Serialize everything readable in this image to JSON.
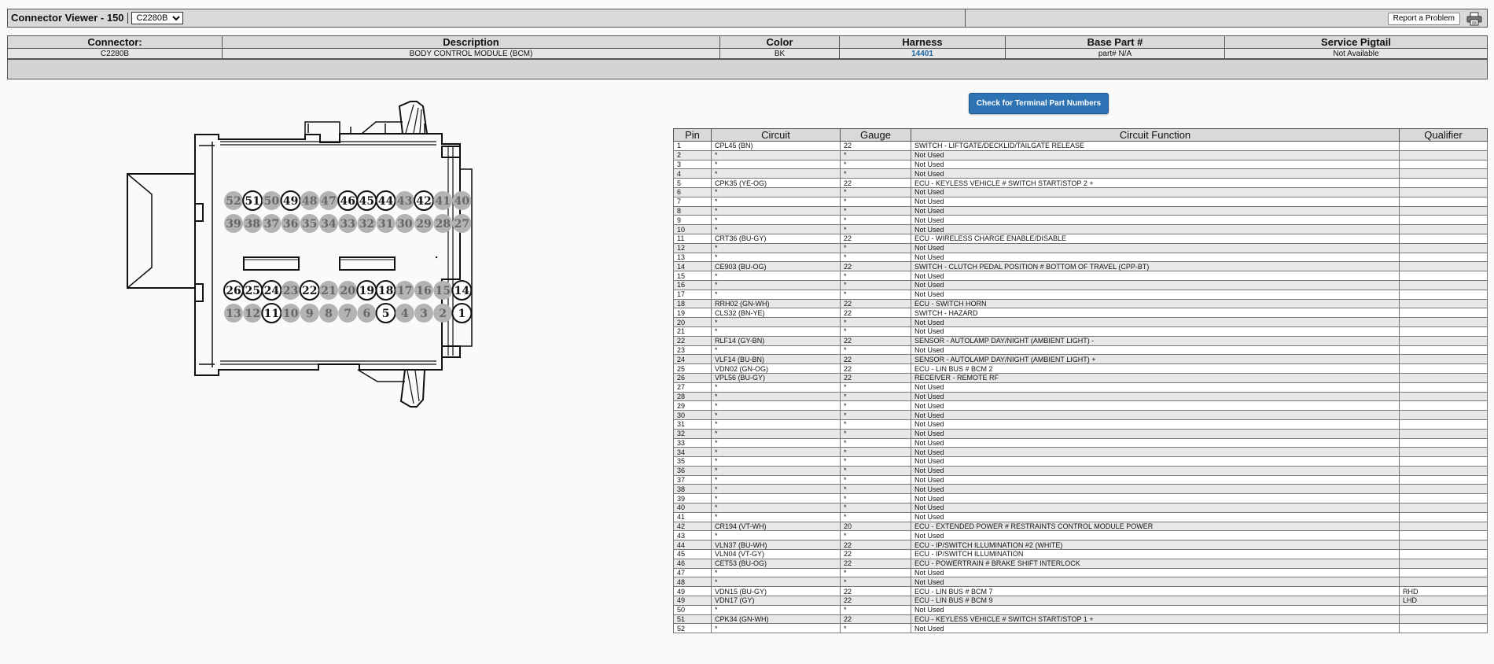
{
  "window": {
    "title": "Connector Viewer - 150",
    "selected_connector": "C2280B",
    "report_label": "Report a Problem",
    "print_icon": "printer-icon"
  },
  "info_table": {
    "headers": [
      "Connector:",
      "Description",
      "Color",
      "Harness",
      "Base Part #",
      "Service Pigtail"
    ],
    "values": [
      "C2280B",
      "BODY CONTROL MODULE (BCM)",
      "BK",
      "14401",
      "part# N/A",
      "Not Available"
    ]
  },
  "check_button": "Check for Terminal Part Numbers",
  "connector_pins": {
    "row1": [
      {
        "n": "52",
        "active": false
      },
      {
        "n": "51",
        "active": true
      },
      {
        "n": "50",
        "active": false
      },
      {
        "n": "49",
        "active": true
      },
      {
        "n": "48",
        "active": false
      },
      {
        "n": "47",
        "active": false
      },
      {
        "n": "46",
        "active": true
      },
      {
        "n": "45",
        "active": true
      },
      {
        "n": "44",
        "active": true
      },
      {
        "n": "43",
        "active": false
      },
      {
        "n": "42",
        "active": true
      },
      {
        "n": "41",
        "active": false
      },
      {
        "n": "40",
        "active": false
      }
    ],
    "row2": [
      {
        "n": "39",
        "active": false
      },
      {
        "n": "38",
        "active": false
      },
      {
        "n": "37",
        "active": false
      },
      {
        "n": "36",
        "active": false
      },
      {
        "n": "35",
        "active": false
      },
      {
        "n": "34",
        "active": false
      },
      {
        "n": "33",
        "active": false
      },
      {
        "n": "32",
        "active": false
      },
      {
        "n": "31",
        "active": false
      },
      {
        "n": "30",
        "active": false
      },
      {
        "n": "29",
        "active": false
      },
      {
        "n": "28",
        "active": false
      },
      {
        "n": "27",
        "active": false
      }
    ],
    "row3": [
      {
        "n": "26",
        "active": true
      },
      {
        "n": "25",
        "active": true
      },
      {
        "n": "24",
        "active": true
      },
      {
        "n": "23",
        "active": false
      },
      {
        "n": "22",
        "active": true
      },
      {
        "n": "21",
        "active": false
      },
      {
        "n": "20",
        "active": false
      },
      {
        "n": "19",
        "active": true
      },
      {
        "n": "18",
        "active": true
      },
      {
        "n": "17",
        "active": false
      },
      {
        "n": "16",
        "active": false
      },
      {
        "n": "15",
        "active": false
      },
      {
        "n": "14",
        "active": true
      }
    ],
    "row4": [
      {
        "n": "13",
        "active": false
      },
      {
        "n": "12",
        "active": false
      },
      {
        "n": "11",
        "active": true
      },
      {
        "n": "10",
        "active": false
      },
      {
        "n": "9",
        "active": false
      },
      {
        "n": "8",
        "active": false
      },
      {
        "n": "7",
        "active": false
      },
      {
        "n": "6",
        "active": false
      },
      {
        "n": "5",
        "active": true
      },
      {
        "n": "4",
        "active": false
      },
      {
        "n": "3",
        "active": false
      },
      {
        "n": "2",
        "active": false
      },
      {
        "n": "1",
        "active": true
      }
    ]
  },
  "pin_table": {
    "headers": [
      "Pin",
      "Circuit",
      "Gauge",
      "Circuit Function",
      "Qualifier"
    ],
    "rows": [
      [
        "1",
        "CPL45 (BN)",
        "22",
        "SWITCH - LIFTGATE/DECKLID/TAILGATE RELEASE",
        ""
      ],
      [
        "2",
        "*",
        "*",
        "Not Used",
        ""
      ],
      [
        "3",
        "*",
        "*",
        "Not Used",
        ""
      ],
      [
        "4",
        "*",
        "*",
        "Not Used",
        ""
      ],
      [
        "5",
        "CPK35 (YE-OG)",
        "22",
        "ECU - KEYLESS VEHICLE # SWITCH START/STOP 2 +",
        ""
      ],
      [
        "6",
        "*",
        "*",
        "Not Used",
        ""
      ],
      [
        "7",
        "*",
        "*",
        "Not Used",
        ""
      ],
      [
        "8",
        "*",
        "*",
        "Not Used",
        ""
      ],
      [
        "9",
        "*",
        "*",
        "Not Used",
        ""
      ],
      [
        "10",
        "*",
        "*",
        "Not Used",
        ""
      ],
      [
        "11",
        "CRT36 (BU-GY)",
        "22",
        "ECU - WIRELESS CHARGE ENABLE/DISABLE",
        ""
      ],
      [
        "12",
        "*",
        "*",
        "Not Used",
        ""
      ],
      [
        "13",
        "*",
        "*",
        "Not Used",
        ""
      ],
      [
        "14",
        "CE903 (BU-OG)",
        "22",
        "SWITCH - CLUTCH PEDAL POSITION # BOTTOM OF TRAVEL (CPP-BT)",
        ""
      ],
      [
        "15",
        "*",
        "*",
        "Not Used",
        ""
      ],
      [
        "16",
        "*",
        "*",
        "Not Used",
        ""
      ],
      [
        "17",
        "*",
        "*",
        "Not Used",
        ""
      ],
      [
        "18",
        "RRH02 (GN-WH)",
        "22",
        "ECU - SWITCH HORN",
        ""
      ],
      [
        "19",
        "CLS32 (BN-YE)",
        "22",
        "SWITCH - HAZARD",
        ""
      ],
      [
        "20",
        "*",
        "*",
        "Not Used",
        ""
      ],
      [
        "21",
        "*",
        "*",
        "Not Used",
        ""
      ],
      [
        "22",
        "RLF14 (GY-BN)",
        "22",
        "SENSOR - AUTOLAMP DAY/NIGHT (AMBIENT LIGHT) -",
        ""
      ],
      [
        "23",
        "*",
        "*",
        "Not Used",
        ""
      ],
      [
        "24",
        "VLF14 (BU-BN)",
        "22",
        "SENSOR - AUTOLAMP DAY/NIGHT (AMBIENT LIGHT) +",
        ""
      ],
      [
        "25",
        "VDN02 (GN-OG)",
        "22",
        "ECU - LIN BUS # BCM 2",
        ""
      ],
      [
        "26",
        "VPL56 (BU-GY)",
        "22",
        "RECEIVER - REMOTE RF",
        ""
      ],
      [
        "27",
        "*",
        "*",
        "Not Used",
        ""
      ],
      [
        "28",
        "*",
        "*",
        "Not Used",
        ""
      ],
      [
        "29",
        "*",
        "*",
        "Not Used",
        ""
      ],
      [
        "30",
        "*",
        "*",
        "Not Used",
        ""
      ],
      [
        "31",
        "*",
        "*",
        "Not Used",
        ""
      ],
      [
        "32",
        "*",
        "*",
        "Not Used",
        ""
      ],
      [
        "33",
        "*",
        "*",
        "Not Used",
        ""
      ],
      [
        "34",
        "*",
        "*",
        "Not Used",
        ""
      ],
      [
        "35",
        "*",
        "*",
        "Not Used",
        ""
      ],
      [
        "36",
        "*",
        "*",
        "Not Used",
        ""
      ],
      [
        "37",
        "*",
        "*",
        "Not Used",
        ""
      ],
      [
        "38",
        "*",
        "*",
        "Not Used",
        ""
      ],
      [
        "39",
        "*",
        "*",
        "Not Used",
        ""
      ],
      [
        "40",
        "*",
        "*",
        "Not Used",
        ""
      ],
      [
        "41",
        "*",
        "*",
        "Not Used",
        ""
      ],
      [
        "42",
        "CR194 (VT-WH)",
        "20",
        "ECU - EXTENDED POWER # RESTRAINTS CONTROL MODULE POWER",
        ""
      ],
      [
        "43",
        "*",
        "*",
        "Not Used",
        ""
      ],
      [
        "44",
        "VLN37 (BU-WH)",
        "22",
        "ECU - IP/SWITCH ILLUMINATION #2 (WHITE)",
        ""
      ],
      [
        "45",
        "VLN04 (VT-GY)",
        "22",
        "ECU - IP/SWITCH ILLUMINATION",
        ""
      ],
      [
        "46",
        "CET53 (BU-OG)",
        "22",
        "ECU - POWERTRAIN # BRAKE SHIFT INTERLOCK",
        ""
      ],
      [
        "47",
        "*",
        "*",
        "Not Used",
        ""
      ],
      [
        "48",
        "*",
        "*",
        "Not Used",
        ""
      ],
      [
        "49",
        "VDN15 (BU-GY)",
        "22",
        "ECU - LIN BUS # BCM 7",
        "RHD"
      ],
      [
        "49",
        "VDN17 (GY)",
        "22",
        "ECU - LIN BUS # BCM 9",
        "LHD"
      ],
      [
        "50",
        "*",
        "*",
        "Not Used",
        ""
      ],
      [
        "51",
        "CPK34 (GN-WH)",
        "22",
        "ECU - KEYLESS VEHICLE # SWITCH START/STOP 1 +",
        ""
      ],
      [
        "52",
        "*",
        "*",
        "Not Used",
        ""
      ]
    ]
  }
}
